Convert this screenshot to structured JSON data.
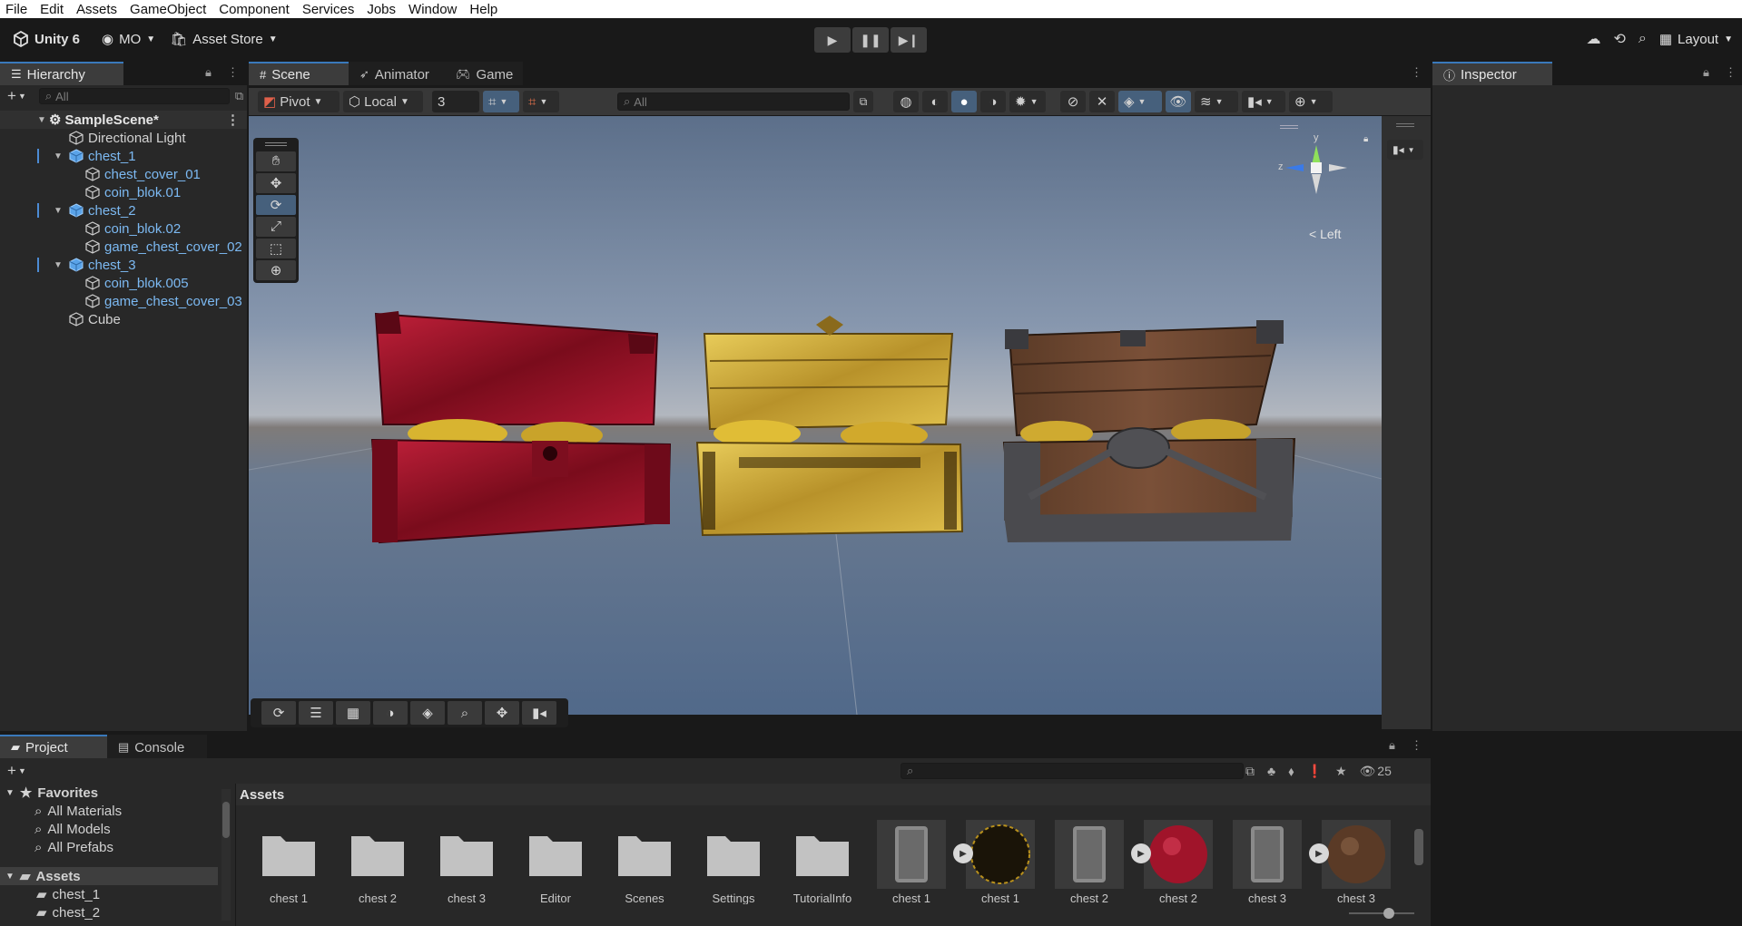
{
  "menu": [
    "File",
    "Edit",
    "Assets",
    "GameObject",
    "Component",
    "Services",
    "Jobs",
    "Window",
    "Help"
  ],
  "toolbar": {
    "product": "Unity 6",
    "account": "MO",
    "asset_store": "Asset Store",
    "layout": "Layout",
    "play_icon": "play-icon",
    "pause_icon": "pause-icon",
    "step_icon": "step-icon"
  },
  "hierarchy": {
    "tab": "Hierarchy",
    "search_placeholder": "All",
    "scene": "SampleScene*",
    "items": [
      {
        "label": "Directional Light"
      },
      {
        "label": "chest_1"
      },
      {
        "label": "chest_cover_01"
      },
      {
        "label": "coin_blok.01"
      },
      {
        "label": "chest_2"
      },
      {
        "label": "coin_blok.02"
      },
      {
        "label": "game_chest_cover_02"
      },
      {
        "label": "chest_3"
      },
      {
        "label": "coin_blok.005"
      },
      {
        "label": "game_chest_cover_03"
      },
      {
        "label": "Cube"
      }
    ]
  },
  "scene_tabs": [
    "Scene",
    "Animator",
    "Game"
  ],
  "scene_toolbar": {
    "pivot": "Pivot",
    "local": "Local",
    "grid_size": "3",
    "search_placeholder": "All"
  },
  "gizmo": {
    "y": "y",
    "z": "z",
    "view": "Left"
  },
  "inspector": {
    "tab": "Inspector"
  },
  "project": {
    "tabs": [
      "Project",
      "Console"
    ],
    "hidden_count": "25",
    "breadcrumb": "Assets",
    "favorites": {
      "title": "Favorites",
      "items": [
        "All Materials",
        "All Models",
        "All Prefabs"
      ]
    },
    "tree": {
      "root": "Assets",
      "items": [
        "chest_1",
        "chest_2"
      ]
    },
    "folders": [
      "chest 1",
      "chest 2",
      "chest 3",
      "Editor",
      "Scenes",
      "Settings",
      "TutorialInfo"
    ],
    "models": [
      "chest 1",
      "chest 1",
      "chest 2",
      "chest 2",
      "chest 3",
      "chest 3"
    ]
  },
  "colors": {
    "accent": "#3a79bb",
    "prefab_text": "#7cb9f2",
    "chest_red": "#a0142a",
    "chest_gold": "#d4b23a",
    "chest_wood": "#6a4630"
  }
}
